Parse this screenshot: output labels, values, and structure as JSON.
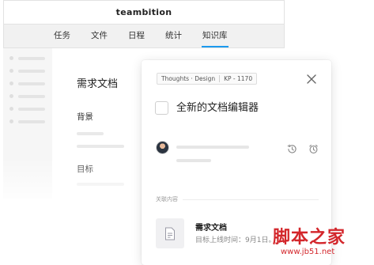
{
  "app": {
    "title": "teambition"
  },
  "nav": {
    "tabs": [
      {
        "label": "任务"
      },
      {
        "label": "文件"
      },
      {
        "label": "日程"
      },
      {
        "label": "统计"
      },
      {
        "label": "知识库",
        "active": true
      }
    ]
  },
  "document": {
    "title": "需求文档",
    "sections": [
      {
        "label": "背景"
      },
      {
        "label": "目标"
      }
    ]
  },
  "card": {
    "breadcrumb": {
      "project": "Thoughts · Design",
      "id": "KP - 1170"
    },
    "task_title": "全新的文档编辑器",
    "related_section_label": "关联内容",
    "related_item": {
      "title": "需求文档",
      "subtitle": "目标上线时间：9月1日。"
    },
    "icons": {
      "close": "close-icon",
      "history": "history-icon",
      "reminder": "alarm-clock-icon",
      "file": "document-icon"
    }
  },
  "watermark": {
    "text": "脚本之家",
    "url": "www.jb51.net"
  },
  "colors": {
    "accent": "#1b9aee",
    "watermark": "#d3262b"
  }
}
